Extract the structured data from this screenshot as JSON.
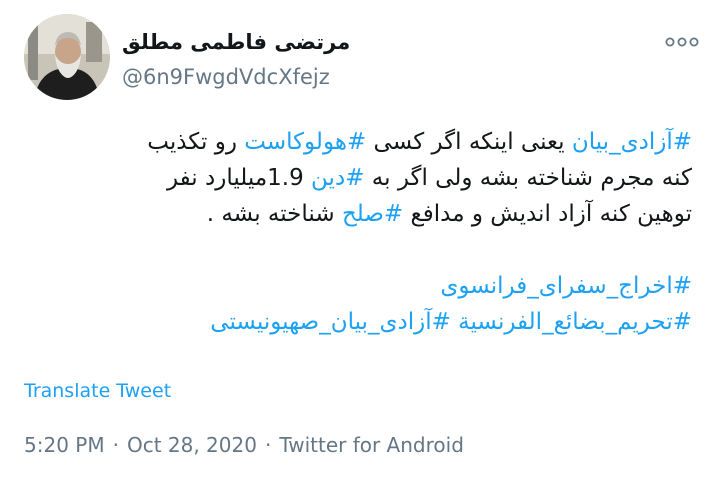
{
  "author": {
    "display_name": "مرتضی فاطمی مطلق",
    "handle": "@6n9FwgdVdcXfejz"
  },
  "more_icon": "more-options-icon",
  "tweet": {
    "line1": {
      "tag1": "#آزادی_بیان",
      "text1": " یعنی اینکه اگر کسی ",
      "tag2": "#هولوکاست",
      "text2": " رو تکذیب"
    },
    "line2": {
      "text1": "کنه مجرم شناخته بشه ولی اگر به ",
      "tag1": "#دین",
      "text2": " 1.9میلیارد نفر"
    },
    "line3": {
      "text1": "توهین کنه آزاد اندیش و مدافع ",
      "tag1": "#صلح",
      "text2": " شناخته بشه ."
    },
    "hashtags": [
      "#اخراج_سفرای_فرانسوی",
      "#تحریم_بضائع_الفرنسیة #آزادی_بیان_صهیونیستی"
    ]
  },
  "translate_label": "Translate Tweet",
  "meta": {
    "time": "5:20 PM",
    "date": "Oct 28, 2020",
    "separator": "·",
    "source": "Twitter for Android"
  },
  "colors": {
    "link": "#1da1f2",
    "text": "#14171a",
    "secondary": "#657786"
  }
}
